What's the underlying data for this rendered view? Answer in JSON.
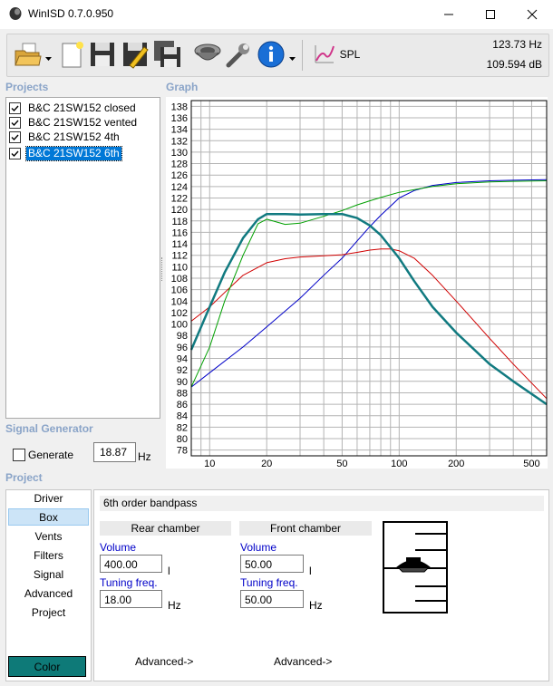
{
  "window": {
    "title": "WinISD 0.7.0.950"
  },
  "toolbar": {
    "spl_label": "SPL",
    "readout_freq": "123.73 Hz",
    "readout_db": "109.594 dB"
  },
  "sections": {
    "projects": "Projects",
    "graph": "Graph",
    "signal_generator": "Signal Generator",
    "project": "Project"
  },
  "projects": [
    {
      "label": "B&C 21SW152 closed",
      "checked": true,
      "selected": false
    },
    {
      "label": "B&C 21SW152 vented",
      "checked": true,
      "selected": false
    },
    {
      "label": "B&C 21SW152 4th",
      "checked": true,
      "selected": false
    },
    {
      "label": "B&C 21SW152 6th",
      "checked": true,
      "selected": true
    }
  ],
  "signal_generator": {
    "generate_label": "Generate",
    "value": "18.87",
    "unit": "Hz"
  },
  "nav": [
    {
      "label": "Driver"
    },
    {
      "label": "Box"
    },
    {
      "label": "Vents"
    },
    {
      "label": "Filters"
    },
    {
      "label": "Signal"
    },
    {
      "label": "Advanced"
    },
    {
      "label": "Project"
    }
  ],
  "color_button": "Color",
  "box": {
    "type": "6th order bandpass",
    "rear": {
      "header": "Rear chamber",
      "volume_label": "Volume",
      "volume_value": "400.00",
      "volume_unit": "l",
      "tuning_label": "Tuning freq.",
      "tuning_value": "18.00",
      "tuning_unit": "Hz",
      "advanced": "Advanced->"
    },
    "front": {
      "header": "Front chamber",
      "volume_label": "Volume",
      "volume_value": "50.00",
      "volume_unit": "l",
      "tuning_label": "Tuning freq.",
      "tuning_value": "50.00",
      "tuning_unit": "Hz",
      "advanced": "Advanced->"
    }
  },
  "chart_data": {
    "type": "line",
    "x_scale": "log",
    "xlim": [
      8,
      600
    ],
    "ylim": [
      77,
      139
    ],
    "x_ticks": [
      10,
      20,
      50,
      100,
      200,
      500
    ],
    "y_ticks": [
      78,
      80,
      82,
      84,
      86,
      88,
      90,
      92,
      94,
      96,
      98,
      100,
      102,
      104,
      106,
      108,
      110,
      112,
      114,
      116,
      118,
      120,
      122,
      124,
      126,
      128,
      130,
      132,
      134,
      136,
      138
    ],
    "grid": true,
    "series": [
      {
        "color": "#0000c8",
        "width": 1,
        "x": [
          8,
          10,
          15,
          20,
          30,
          40,
          50,
          60,
          70,
          80,
          100,
          120,
          150,
          200,
          300,
          400,
          600
        ],
        "y": [
          89,
          91.5,
          96,
          99.5,
          104.5,
          108.5,
          111.5,
          114.5,
          117,
          119,
          122,
          123.3,
          124.2,
          124.7,
          125,
          125.1,
          125.2
        ]
      },
      {
        "color": "#d00000",
        "width": 1,
        "x": [
          8,
          10,
          12,
          15,
          20,
          25,
          30,
          40,
          50,
          60,
          70,
          80,
          90,
          100,
          120,
          150,
          200,
          300,
          400,
          600
        ],
        "y": [
          100.5,
          103,
          105.5,
          108.5,
          110.7,
          111.4,
          111.7,
          111.9,
          112.1,
          112.5,
          112.9,
          113.1,
          113.1,
          112.8,
          111.5,
          108.5,
          104,
          97.5,
          93,
          87
        ]
      },
      {
        "color": "#00a000",
        "width": 1,
        "x": [
          8,
          10,
          12,
          15,
          18,
          20,
          25,
          30,
          40,
          50,
          60,
          70,
          80,
          100,
          150,
          200,
          300,
          400,
          600
        ],
        "y": [
          89,
          96,
          104,
          112,
          117.5,
          118.3,
          117.4,
          117.6,
          118.8,
          119.8,
          120.8,
          121.5,
          122.1,
          123,
          124,
          124.5,
          124.8,
          124.9,
          125
        ]
      },
      {
        "color": "#117a80",
        "width": 2.5,
        "x": [
          8,
          10,
          12,
          15,
          18,
          20,
          25,
          30,
          40,
          50,
          60,
          70,
          80,
          100,
          120,
          150,
          200,
          300,
          400,
          600
        ],
        "y": [
          95.5,
          103,
          109,
          115,
          118.3,
          119.2,
          119.2,
          119.1,
          119.2,
          119.2,
          118.5,
          117.2,
          115.5,
          111.5,
          107.5,
          103,
          98.5,
          93,
          90,
          86
        ]
      }
    ]
  }
}
